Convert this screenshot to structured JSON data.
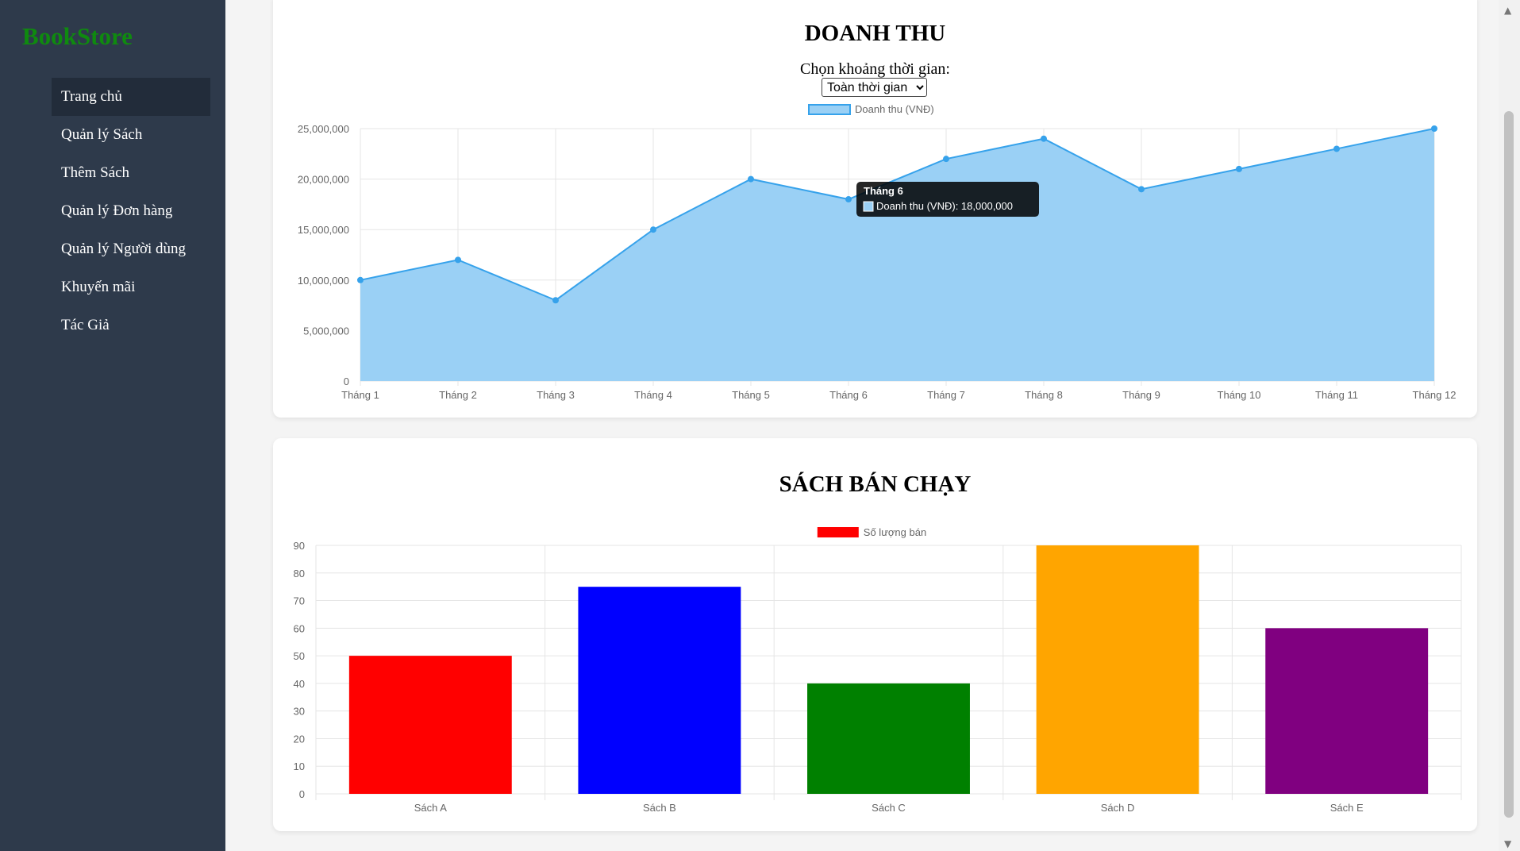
{
  "sidebar": {
    "brand": "BookStore",
    "items": [
      {
        "label": "Trang chủ",
        "active": true
      },
      {
        "label": "Quản lý Sách"
      },
      {
        "label": "Thêm Sách"
      },
      {
        "label": "Quản lý Đơn hàng"
      },
      {
        "label": "Quản lý Người dùng"
      },
      {
        "label": "Khuyến mãi"
      },
      {
        "label": "Tác Giả"
      }
    ]
  },
  "revenue": {
    "title": "DOANH THU",
    "period_label": "Chọn khoảng thời gian:",
    "period_selected": "Toàn thời gian",
    "tooltip": {
      "title": "Tháng 6",
      "body": "Doanh thu (VNĐ): 18,000,000"
    }
  },
  "best_sellers": {
    "title": "SÁCH BÁN CHẠY"
  },
  "chart_data": [
    {
      "type": "area",
      "categories": [
        "Tháng 1",
        "Tháng 2",
        "Tháng 3",
        "Tháng 4",
        "Tháng 5",
        "Tháng 6",
        "Tháng 7",
        "Tháng 8",
        "Tháng 9",
        "Tháng 10",
        "Tháng 11",
        "Tháng 12"
      ],
      "series": [
        {
          "name": "Doanh thu (VNĐ)",
          "values": [
            10000000,
            12000000,
            8000000,
            15000000,
            20000000,
            18000000,
            22000000,
            24000000,
            19000000,
            21000000,
            23000000,
            25000000
          ]
        }
      ],
      "y_ticks": [
        "0",
        "5,000,000",
        "10,000,000",
        "15,000,000",
        "20,000,000",
        "25,000,000"
      ],
      "ylim": [
        0,
        25000000
      ],
      "grid": true,
      "legend": "top",
      "line_color": "#36a2eb",
      "fill_color": "#9ad0f5"
    },
    {
      "type": "bar",
      "categories": [
        "Sách A",
        "Sách B",
        "Sách C",
        "Sách D",
        "Sách E"
      ],
      "series": [
        {
          "name": "Số lượng bán",
          "values": [
            50,
            75,
            40,
            90,
            60
          ]
        }
      ],
      "colors": [
        "#ff0000",
        "#0000ff",
        "#008000",
        "#ffa500",
        "#800080"
      ],
      "y_ticks": [
        "0",
        "10",
        "20",
        "30",
        "40",
        "50",
        "60",
        "70",
        "80",
        "90"
      ],
      "ylim": [
        0,
        90
      ],
      "grid": true,
      "legend": "top"
    }
  ]
}
